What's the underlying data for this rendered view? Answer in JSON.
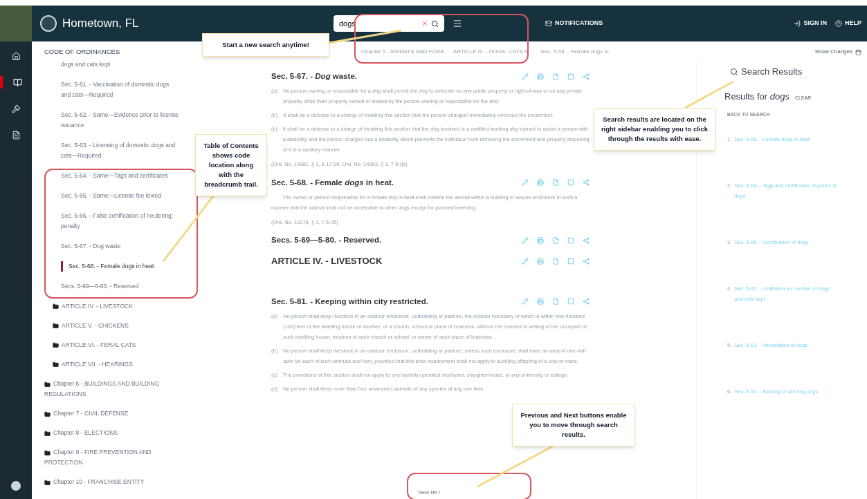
{
  "header": {
    "logo_text": "Hometown, FL",
    "search": {
      "value": "dogs"
    },
    "notifications": "NOTIFICATIONS",
    "sign_in": "SIGN IN",
    "help": "HELP"
  },
  "rail": [
    {
      "kind": "home",
      "selected": false
    },
    {
      "kind": "book",
      "selected": true
    },
    {
      "kind": "gavel",
      "selected": false
    },
    {
      "kind": "file",
      "selected": false
    }
  ],
  "toc": {
    "title": "CODE OF ORDINANCES",
    "sections": [
      {
        "label": "dogs and cats kept",
        "selected": false
      },
      {
        "label": "Sec. 5-61. - Vaccination of domestic dogs and cats—Required",
        "selected": false
      },
      {
        "label": "Sec. 5-62. - Same—Evidence prior to license issuance",
        "selected": false
      },
      {
        "label": "Sec. 5-63. - Licensing of domestic dogs and cats—Required",
        "selected": false
      },
      {
        "label": "Sec. 5-64. - Same—Tags and certificates",
        "selected": false
      },
      {
        "label": "Sec. 5-65. - Same—License fee levied",
        "selected": false
      },
      {
        "label": "Sec. 5-66. - False certification of neutering; penalty",
        "selected": false
      },
      {
        "label": "Sec. 5-67. - Dog waste",
        "selected": false
      },
      {
        "label": "Sec. 5-68. - Female dogs in heat",
        "selected": true
      },
      {
        "label": "Secs. 5-69—5-80. - Reserved",
        "selected": false
      }
    ],
    "articles": [
      "ARTICLE IV. - LIVESTOCK",
      "ARTICLE V. - CHICKENS",
      "ARTICLE VI. - FERAL CATS",
      "ARTICLE VII. - HEARINGS"
    ],
    "chapters": [
      "Chapter 6 - BUILDINGS AND BUILDING REGULATIONS",
      "Chapter 7 - CIVIL DEFENSE",
      "Chapter 8 - ELECTIONS",
      "Chapter 9 - FIRE PREVENTION AND PROTECTION",
      "Chapter 10 - FRANCHISE ENTITY"
    ]
  },
  "breadcrumb": [
    "Chapter 5 - ANIMALS AND FOWL",
    "ARTICLE III. - DOGS, CATS A...",
    "Sec. 5-68. - Female dogs in"
  ],
  "show_changes": "Show Changes",
  "sections": [
    {
      "kind": "section",
      "title": "Sec. 5-67. - *Dog* waste.",
      "paragraphs": [
        {
          "marker": "(a)",
          "text": "No person owning or responsible for a *dog* shall permit the *dog* to defecate on any public property or right-of-way or on any private property other than property owned or leased by the person owning or responsible for the *dog*."
        },
        {
          "marker": "(b)",
          "text": "It shall be a defense to a charge of violating this section that the person charged immediately removed the excrement."
        },
        {
          "marker": "(c)",
          "text": "It shall be a defense to a charge of violating this section that the *dog* involved is a certified working *dog* trained to assist a person with a disability and the person charged has a disability which prevents the individual from removing the excrement and properly disposing of it in a sanitary manner."
        }
      ],
      "history": "(Ord. No. 14881, § 1, 6-17-96; Ord. No. 14983, § 1, 7-5-96)"
    },
    {
      "kind": "section",
      "title": "Sec. 5-68. - Female *dogs* in heat.",
      "paragraphs": [
        {
          "text": "The owner or person responsible for a female *dog* in heat shall confine the animal within a building or secure enclosure in such a manner that the animal shall not be accessible to other *dogs* except for planned breeding."
        }
      ],
      "history": "(Ord. No. 19376, § 1, 7-5-05)"
    },
    {
      "kind": "section",
      "title": "Secs. 5-69—5-80. - Reserved."
    },
    {
      "kind": "article",
      "title": "ARTICLE IV. - LIVESTOCK"
    },
    {
      "kind": "section",
      "title": "Sec. 5-81. - Keeping within city restricted.",
      "paragraphs": [
        {
          "marker": "(a)",
          "text": "No person shall keep livestock in an outdoor enclosure, outbuilding or pasture, the exterior boundary of which is within one hundred (100) feet of the dwelling house of another, or a church, school or place of business, without the consent in writing of the occupant of such dwelling house, trustees of such church or school, or owner of such place of business."
        },
        {
          "marker": "(b)",
          "text": "No person shall keep livestock in an outdoor enclosure, outbuilding or pasture, unless such enclosure shall have an area of one-half acre for each of such animals and fowl, provided that this area requirement shall not apply to suckling offspring of a cow or mare."
        },
        {
          "marker": "(c)",
          "text": "The provisions of this section shall not apply to any lawfully operated stockyard, slaughterhouse, or any university or college."
        },
        {
          "marker": "(d)",
          "text": "No person shall keep more than four unweaned animals of any species at any one time."
        }
      ]
    }
  ],
  "next_hit": "Next Hit",
  "search_results": {
    "title": "Search Results",
    "results_for": "Results for *dogs*",
    "clear": "CLEAR",
    "back": "BACK TO SEARCH",
    "results": [
      {
        "number": "1.",
        "title": "Sec. 5-68. - Female dogs in heat"
      },
      {
        "number": "2.",
        "title": "Sec. 5-64. - Tags and certificates required of dogs"
      },
      {
        "number": "3.",
        "title": "Sec. 5-66. - Certification of dogs"
      },
      {
        "number": "4.",
        "title": "Sec. 5-60. - Limitation on number of dogs and cats kept"
      },
      {
        "number": "5.",
        "title": "Sec. 5-61. - Vaccination of dogs"
      },
      {
        "number": "6.",
        "title": "Sec. 5-54. - Barking or whining dogs"
      }
    ]
  },
  "callouts": [
    {
      "kind": "search",
      "text": "Start a new search anytime!"
    },
    {
      "kind": "toc",
      "text": "Table of Contents shows code location along with the breadcrumb trail."
    },
    {
      "kind": "results",
      "text": "Search results are located on the right sidebar enabling you to click through the results with ease."
    },
    {
      "kind": "nav",
      "text": "Previous and Next buttons enable you to move through search results."
    }
  ]
}
